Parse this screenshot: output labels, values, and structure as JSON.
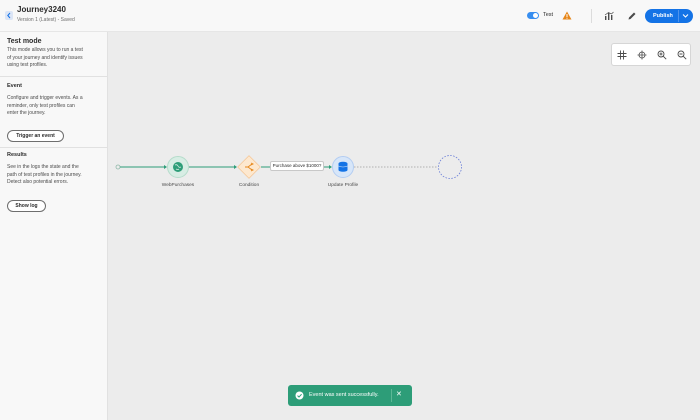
{
  "header": {
    "title": "Journey3240",
    "subtitle": "Version 1 (Latest) - Saved",
    "test_toggle": {
      "label": "Test",
      "on": true
    },
    "publish_label": "Publish",
    "accent_color": "#1473e6"
  },
  "panel": {
    "title": "Test mode",
    "description": [
      "This mode allows you to run a test",
      "of your journey and identify issues",
      "using test profiles."
    ],
    "event_heading": "Event",
    "event_text": [
      "Configure and trigger events. As a",
      "reminder, only test profiles can",
      "enter the journey."
    ],
    "trigger_button": "Trigger an event",
    "results_heading": "Results",
    "results_text": [
      "See in the logs the state and the",
      "path of test profiles in the journey.",
      "Detect also potential errors."
    ],
    "log_button": "Show log"
  },
  "canvas": {
    "tools": [
      "grid-icon",
      "crosshair-icon",
      "zoom-in-icon",
      "zoom-out-icon"
    ],
    "nodes": {
      "event": {
        "label": "WebPurchases",
        "icon": "globe-icon"
      },
      "condition": {
        "label": "Condition",
        "icon": "split-icon",
        "path_label": "Purchase above $1000?"
      },
      "action": {
        "label": "Update Profile",
        "icon": "database-icon"
      },
      "empty": {
        "label": ""
      }
    }
  },
  "toast": {
    "message": "Event was sent successfully.",
    "color": "#2d9d78"
  }
}
